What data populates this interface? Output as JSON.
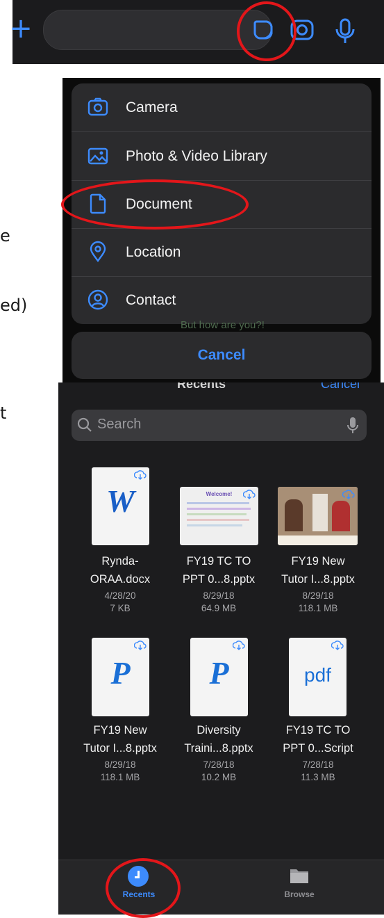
{
  "chat_bar": {
    "plus_icon": "plus-icon",
    "sticker_icon": "sticker-icon",
    "camera_icon": "camera-icon",
    "mic_icon": "microphone-icon",
    "accent": "#3d8bfd"
  },
  "edge_text": {
    "line1": "e",
    "line2": "ed)",
    "line3": "t"
  },
  "background_text": "But how are you?!",
  "action_sheet": {
    "items": [
      {
        "label": "Camera",
        "icon": "camera-icon"
      },
      {
        "label": "Photo & Video Library",
        "icon": "photo-library-icon"
      },
      {
        "label": "Document",
        "icon": "document-icon"
      },
      {
        "label": "Location",
        "icon": "location-pin-icon"
      },
      {
        "label": "Contact",
        "icon": "contact-icon"
      }
    ],
    "cancel": "Cancel"
  },
  "picker": {
    "title": "Recents",
    "cancel": "Cancel",
    "search_placeholder": "Search",
    "files": [
      {
        "name1": "Rynda-",
        "name2": "ORAA.docx",
        "date": "4/28/20",
        "size": "7 KB",
        "kind": "word"
      },
      {
        "name1": "FY19 TC TO",
        "name2": "PPT 0...8.pptx",
        "date": "8/29/18",
        "size": "64.9 MB",
        "kind": "slide-welcome"
      },
      {
        "name1": "FY19 New",
        "name2": "Tutor I...8.pptx",
        "date": "8/29/18",
        "size": "118.1 MB",
        "kind": "slide-photo"
      },
      {
        "name1": "FY19 New",
        "name2": "Tutor I...8.pptx",
        "date": "8/29/18",
        "size": "118.1 MB",
        "kind": "powerpoint"
      },
      {
        "name1": "Diversity",
        "name2": "Traini...8.pptx",
        "date": "7/28/18",
        "size": "10.2 MB",
        "kind": "powerpoint"
      },
      {
        "name1": "FY19 TC TO",
        "name2": "PPT 0...Script",
        "date": "7/28/18",
        "size": "11.3 MB",
        "kind": "pdf"
      }
    ],
    "thumb_text": {
      "word_letter": "W",
      "ppt_letter": "P",
      "pdf_text": "pdf",
      "welcome_title": "Welcome!"
    },
    "tabs": [
      {
        "label": "Recents",
        "icon": "clock-icon",
        "active": true
      },
      {
        "label": "Browse",
        "icon": "folder-icon",
        "active": false
      }
    ]
  },
  "annotation_color": "#e3161a"
}
